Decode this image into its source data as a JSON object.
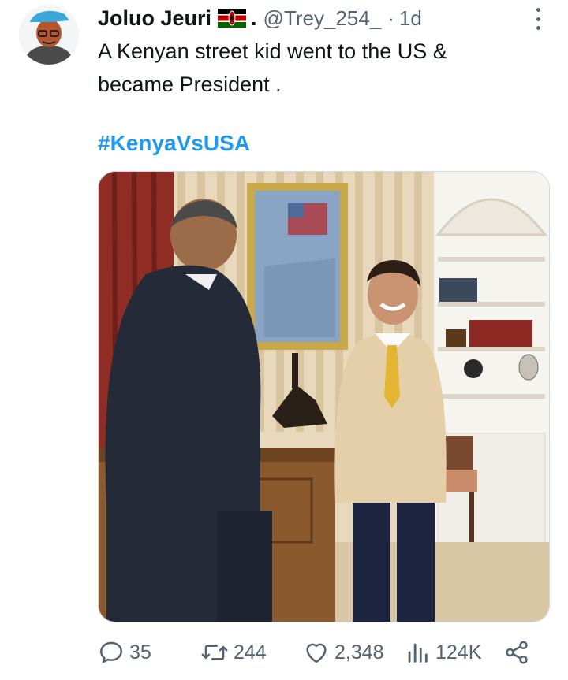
{
  "tweet": {
    "author_name": "Joluo Jeuri",
    "author_suffix": ".",
    "handle": "@Trey_254_",
    "separator": "·",
    "time": "1d",
    "text": "A Kenyan street kid went to the US &\nbecame President .",
    "hashtag": "#KenyaVsUSA",
    "flag_icon": "kenya-flag-emoji"
  },
  "actions": {
    "replies": "35",
    "retweets": "244",
    "likes": "2,348",
    "views": "124K"
  },
  "colors": {
    "hashtag": "#1d9bf0",
    "muted": "#536471",
    "text": "#0f1419"
  }
}
